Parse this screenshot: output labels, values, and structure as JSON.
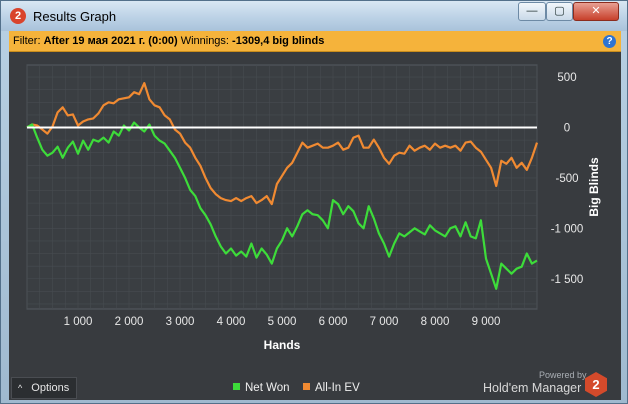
{
  "window": {
    "title": "Results Graph",
    "app_icon": "2",
    "minimize_glyph": "—",
    "maximize_glyph": "▢",
    "close_glyph": "✕"
  },
  "filter": {
    "label": "Filter:",
    "value": "After 19 мая 2021 г. (0:00)",
    "winnings_label": "Winnings:",
    "winnings_value": "-1309,4 big blinds",
    "help": "?"
  },
  "options": {
    "label": "Options",
    "glyph": "^"
  },
  "legend": [
    {
      "label": "Net Won",
      "color": "#3ddc3a"
    },
    {
      "label": "All-In EV",
      "color": "#f08a32"
    }
  ],
  "branding": {
    "powered_by": "Powered by",
    "name": "Hold'em Manager",
    "logo": "2"
  },
  "colors": {
    "background": "#383b3f",
    "filter_bar": "#f5b33b",
    "grid": "#4b5157",
    "zero_line": "#ffffff"
  },
  "chart_data": {
    "type": "line",
    "xlabel": "Hands",
    "ylabel": "Big Blinds",
    "xlim": [
      0,
      10000
    ],
    "ylim": [
      -1800,
      620
    ],
    "x_ticks": [
      "1 000",
      "2 000",
      "3 000",
      "4 000",
      "5 000",
      "6 000",
      "7 000",
      "8 000",
      "9 000"
    ],
    "y_ticks": [
      "500",
      "0",
      "-500",
      "-1 000",
      "-1 500"
    ],
    "y_tick_values": [
      500,
      0,
      -500,
      -1000,
      -1500
    ],
    "x_tick_values": [
      1000,
      2000,
      3000,
      4000,
      5000,
      6000,
      7000,
      8000,
      9000
    ],
    "grid": true,
    "legend_position": "bottom-center",
    "series": [
      {
        "name": "Net Won",
        "color": "#3ddc3a",
        "x": [
          0,
          100,
          200,
          300,
          400,
          500,
          600,
          700,
          800,
          900,
          1000,
          1100,
          1200,
          1300,
          1400,
          1500,
          1600,
          1700,
          1800,
          1900,
          2000,
          2100,
          2200,
          2300,
          2400,
          2500,
          2600,
          2700,
          2800,
          2900,
          3000,
          3100,
          3200,
          3300,
          3400,
          3500,
          3600,
          3700,
          3800,
          3900,
          4000,
          4100,
          4200,
          4300,
          4400,
          4500,
          4600,
          4700,
          4800,
          4900,
          5000,
          5100,
          5200,
          5300,
          5400,
          5500,
          5600,
          5700,
          5800,
          5900,
          6000,
          6100,
          6200,
          6300,
          6400,
          6500,
          6600,
          6700,
          6800,
          6900,
          7000,
          7100,
          7200,
          7300,
          7400,
          7500,
          7600,
          7700,
          7800,
          7900,
          8000,
          8100,
          8200,
          8300,
          8400,
          8500,
          8600,
          8700,
          8800,
          8900,
          9000,
          9100,
          9200,
          9300,
          9400,
          9500,
          9600,
          9700,
          9800,
          9900,
          10000
        ],
        "y": [
          0,
          30,
          -100,
          -220,
          -280,
          -250,
          -190,
          -300,
          -200,
          -140,
          -260,
          -130,
          -220,
          -120,
          -140,
          -100,
          -150,
          -40,
          -80,
          20,
          -30,
          50,
          0,
          -40,
          30,
          -80,
          -130,
          -160,
          -230,
          -300,
          -400,
          -500,
          -620,
          -680,
          -800,
          -870,
          -960,
          -1080,
          -1180,
          -1250,
          -1200,
          -1270,
          -1230,
          -1280,
          -1150,
          -1290,
          -1200,
          -1260,
          -1350,
          -1200,
          -1120,
          -1000,
          -1080,
          -980,
          -860,
          -820,
          -860,
          -870,
          -920,
          -1000,
          -720,
          -760,
          -860,
          -780,
          -830,
          -950,
          -1000,
          -780,
          -900,
          -1050,
          -1150,
          -1280,
          -1150,
          -1050,
          -1080,
          -1040,
          -1000,
          -1030,
          -1060,
          -970,
          -1020,
          -1050,
          -1080,
          -1000,
          -980,
          -1080,
          -940,
          -1080,
          -1100,
          -920,
          -1300,
          -1450,
          -1600,
          -1350,
          -1400,
          -1450,
          -1400,
          -1380,
          -1250,
          -1350,
          -1320
        ]
      },
      {
        "name": "All-In EV",
        "color": "#f08a32",
        "x": [
          0,
          100,
          200,
          300,
          400,
          500,
          600,
          700,
          800,
          900,
          1000,
          1100,
          1200,
          1300,
          1400,
          1500,
          1600,
          1700,
          1800,
          1900,
          2000,
          2100,
          2200,
          2300,
          2400,
          2500,
          2600,
          2700,
          2800,
          2900,
          3000,
          3100,
          3200,
          3300,
          3400,
          3500,
          3600,
          3700,
          3800,
          3900,
          4000,
          4100,
          4200,
          4300,
          4400,
          4500,
          4600,
          4700,
          4800,
          4900,
          5000,
          5100,
          5200,
          5300,
          5400,
          5500,
          5600,
          5700,
          5800,
          5900,
          6000,
          6100,
          6200,
          6300,
          6400,
          6500,
          6600,
          6700,
          6800,
          6900,
          7000,
          7100,
          7200,
          7300,
          7400,
          7500,
          7600,
          7700,
          7800,
          7900,
          8000,
          8100,
          8200,
          8300,
          8400,
          8500,
          8600,
          8700,
          8800,
          8900,
          9000,
          9100,
          9200,
          9300,
          9400,
          9500,
          9600,
          9700,
          9800,
          9900,
          10000
        ],
        "y": [
          0,
          30,
          20,
          -20,
          -60,
          10,
          150,
          200,
          120,
          130,
          20,
          60,
          80,
          90,
          140,
          220,
          250,
          240,
          280,
          290,
          300,
          350,
          330,
          440,
          280,
          220,
          200,
          120,
          80,
          -20,
          -60,
          -150,
          -200,
          -300,
          -380,
          -500,
          -600,
          -660,
          -700,
          -720,
          -730,
          -700,
          -730,
          -700,
          -680,
          -750,
          -720,
          -680,
          -760,
          -560,
          -480,
          -400,
          -350,
          -250,
          -150,
          -200,
          -180,
          -160,
          -200,
          -200,
          -180,
          -150,
          -220,
          -200,
          -100,
          -80,
          -200,
          -200,
          -120,
          -200,
          -300,
          -360,
          -280,
          -250,
          -260,
          -180,
          -230,
          -200,
          -180,
          -220,
          -160,
          -200,
          -180,
          -200,
          -180,
          -230,
          -150,
          -140,
          -200,
          -240,
          -320,
          -400,
          -580,
          -330,
          -360,
          -300,
          -400,
          -350,
          -420,
          -300,
          -150
        ]
      }
    ]
  }
}
